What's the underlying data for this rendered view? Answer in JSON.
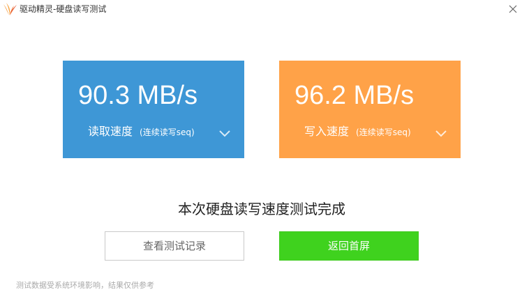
{
  "window": {
    "title": "驱动精灵-硬盘读写测试",
    "logo_icon": "wing-logo-icon",
    "close_icon": "close-icon"
  },
  "read_card": {
    "value": "90.3 MB/s",
    "label": "读取速度",
    "mode": "(连续读写seq)",
    "color": "#3e97d6",
    "chevron_icon": "chevron-down-icon"
  },
  "write_card": {
    "value": "96.2 MB/s",
    "label": "写入速度",
    "mode": "(连续读写seq)",
    "color": "#ffa248",
    "chevron_icon": "chevron-down-icon"
  },
  "result": {
    "message": "本次硬盘读写速度测试完成"
  },
  "buttons": {
    "history_label": "查看测试记录",
    "home_label": "返回首屏",
    "home_color": "#3fd21e"
  },
  "footer": {
    "note": "测试数据受系统环境影响，结果仅供参考"
  }
}
